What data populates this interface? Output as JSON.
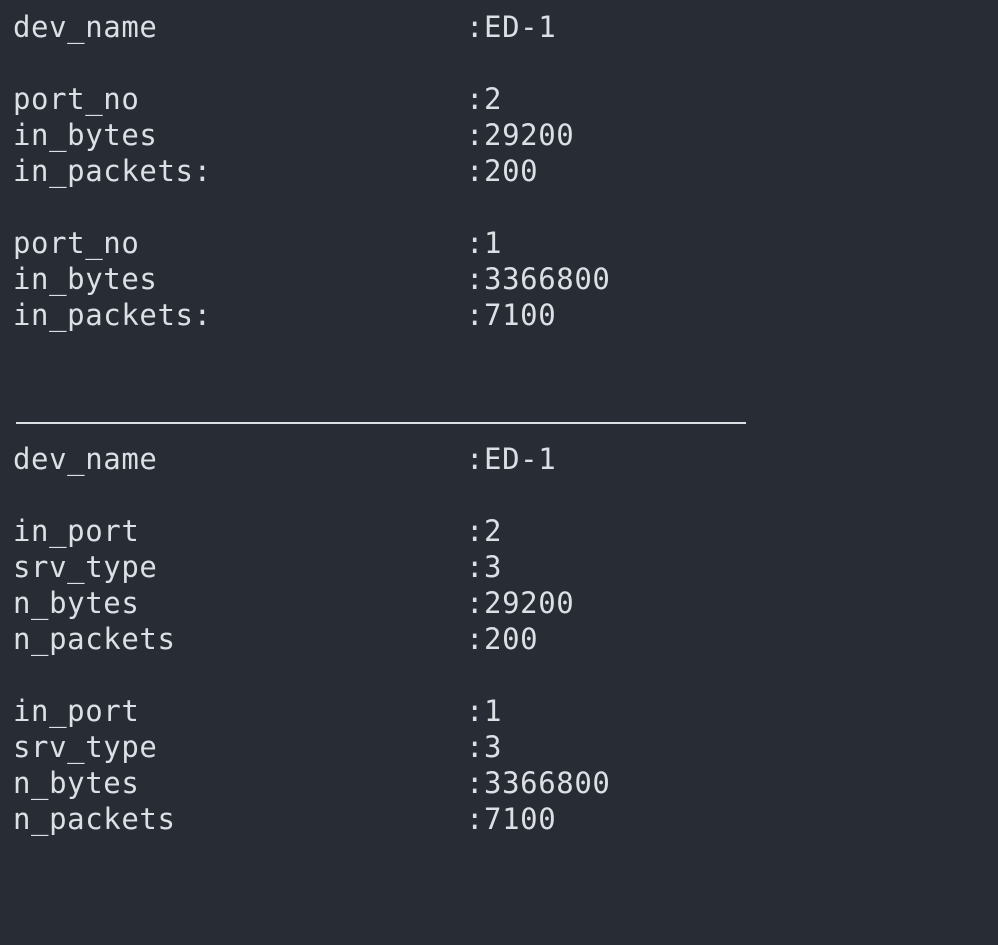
{
  "terminal": {
    "records": [
      {
        "key": "dev_name",
        "value": ":ED-1"
      },
      {
        "key": "port_no",
        "value": ":2"
      },
      {
        "key": "in_bytes",
        "value": ":29200"
      },
      {
        "key": "in_packets:",
        "value": ":200"
      },
      {
        "key": "port_no",
        "value": ":1"
      },
      {
        "key": "in_bytes",
        "value": ":3366800"
      },
      {
        "key": "in_packets:",
        "value": ":7100"
      },
      {
        "key": "dev_name",
        "value": ":ED-1"
      },
      {
        "key": "in_port",
        "value": ":2"
      },
      {
        "key": "srv_type",
        "value": ":3"
      },
      {
        "key": "n_bytes",
        "value": ":29200"
      },
      {
        "key": "n_packets",
        "value": ":200"
      },
      {
        "key": "in_port",
        "value": ":1"
      },
      {
        "key": "srv_type",
        "value": ":3"
      },
      {
        "key": "n_bytes",
        "value": ":3366800"
      },
      {
        "key": "n_packets",
        "value": ":7100"
      }
    ]
  }
}
